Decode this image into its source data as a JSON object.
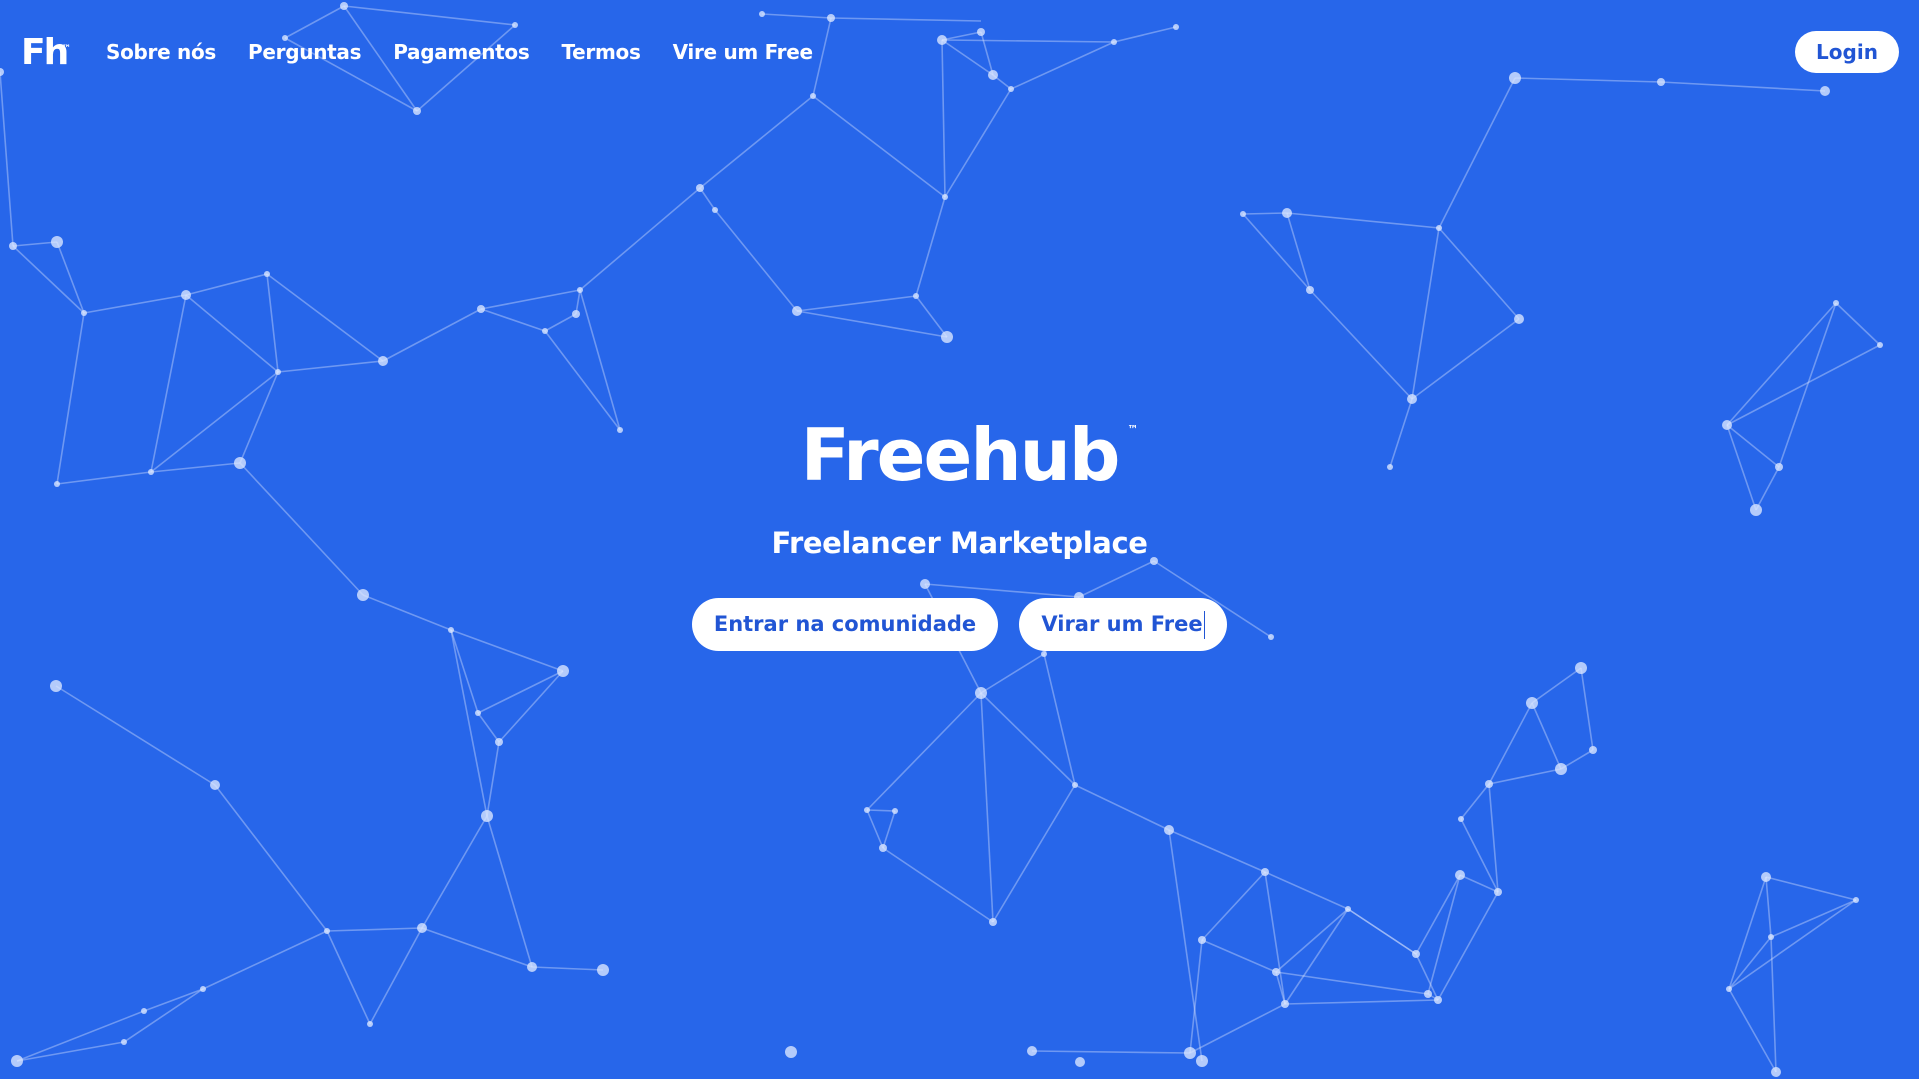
{
  "brand": {
    "logo_text": "Fh",
    "logo_mark": "™"
  },
  "navigation": {
    "links": [
      {
        "label": "Sobre nós"
      },
      {
        "label": "Perguntas"
      },
      {
        "label": "Pagamentos"
      },
      {
        "label": "Termos"
      },
      {
        "label": "Vire um Free"
      }
    ]
  },
  "header": {
    "login_label": "Login"
  },
  "hero": {
    "title": "Freehub",
    "title_mark": "™",
    "subtitle": "Freelancer Marketplace",
    "primary_button": "Entrar na comunidade",
    "secondary_button": "Virar um Free"
  },
  "theme": {
    "background": "#2766ea",
    "accent_text": "#2155d4",
    "foreground": "#ffffff"
  }
}
